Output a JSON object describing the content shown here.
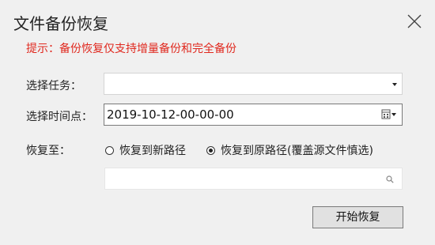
{
  "dialog": {
    "title": "文件备份恢复",
    "hint": "提示：备份恢复仅支持增量备份和完全备份",
    "task": {
      "label": "选择任务：",
      "value": ""
    },
    "timepoint": {
      "label": "选择时间点：",
      "value": "2019-10-12-00-00-00"
    },
    "restore": {
      "label": "恢复至：",
      "option_new": "恢复到新路径",
      "option_original": "恢复到原路径(覆盖源文件慎选)",
      "selected": "option_original",
      "path_value": ""
    },
    "start_label": "开始恢复"
  },
  "icons": {
    "close": "close-icon",
    "dropdown": "chevron-down-icon",
    "calendar": "calendar-icon",
    "search": "search-icon"
  },
  "colors": {
    "hint": "#e0281e",
    "background": "#f0f0f0"
  }
}
